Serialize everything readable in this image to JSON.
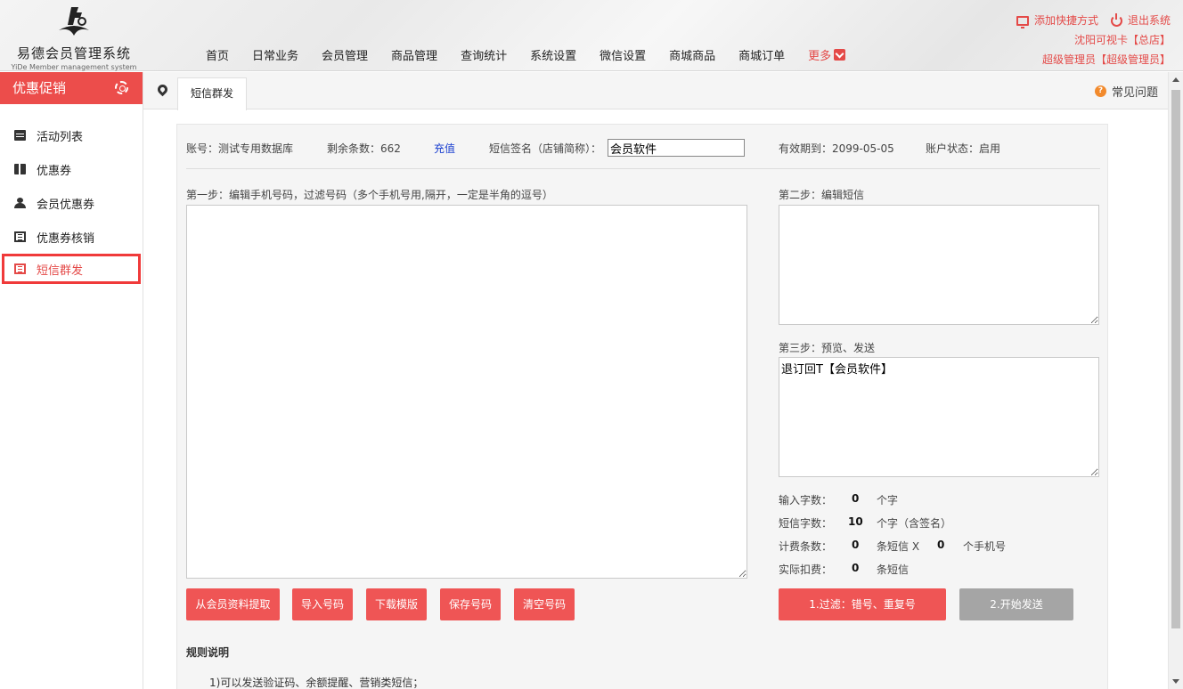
{
  "header": {
    "logo_title": "易德会员管理系统",
    "logo_sub": "YiDe Member management system",
    "nav": [
      "首页",
      "日常业务",
      "会员管理",
      "商品管理",
      "查询统计",
      "系统设置",
      "微信设置",
      "商城商品",
      "商城订单"
    ],
    "nav_more": "更多",
    "add_shortcut": "添加快捷方式",
    "logout": "退出系统",
    "store": "沈阳可视卡【总店】",
    "user": "超级管理员【超级管理员】"
  },
  "sidebar": {
    "title": "优惠促销",
    "items": [
      "活动列表",
      "优惠券",
      "会员优惠券",
      "优惠券核销",
      "短信群发"
    ],
    "active_index": 4
  },
  "tabs": {
    "active": "短信群发",
    "faq": "常见问题"
  },
  "info": {
    "account": "账号：测试专用数据库",
    "remaining": "剩余条数：662",
    "recharge": "充值",
    "sign_label": "短信签名（店铺简称）：",
    "sign_value": "会员软件",
    "expiry": "有效期到：2099-05-05",
    "status": "账户状态：启用"
  },
  "step1": {
    "label": "第一步：编辑手机号码，过滤号码（多个手机号用,隔开，一定是半角的逗号）",
    "value": ""
  },
  "step2": {
    "label": "第二步：编辑短信",
    "value": ""
  },
  "step3": {
    "label": "第三步：预览、发送",
    "value": "退订回T【会员软件】"
  },
  "stats": {
    "input_label": "输入字数：",
    "input_count": "0",
    "input_unit": "个字",
    "sms_label": "短信字数：",
    "sms_count": "10",
    "sms_unit": "个字（含签名）",
    "bill_label": "计费条数：",
    "bill_count": "0",
    "bill_unit": "条短信 X",
    "phone_count": "0",
    "phone_unit": "个手机号",
    "actual_label": "实际扣费：",
    "actual_count": "0",
    "actual_unit": "条短信"
  },
  "buttons": {
    "from_member": "从会员资料提取",
    "import": "导入号码",
    "download_template": "下载模版",
    "save": "保存号码",
    "clear": "清空号码",
    "filter": "1.过滤：错号、重复号",
    "send": "2.开始发送"
  },
  "rules": {
    "title": "规则说明",
    "items": [
      "1)可以发送验证码、余额提醒、营销类短信；"
    ]
  },
  "colors": {
    "accent": "#ec4d4b",
    "link": "#1a3fd0",
    "disabled": "#a5a5a5"
  }
}
